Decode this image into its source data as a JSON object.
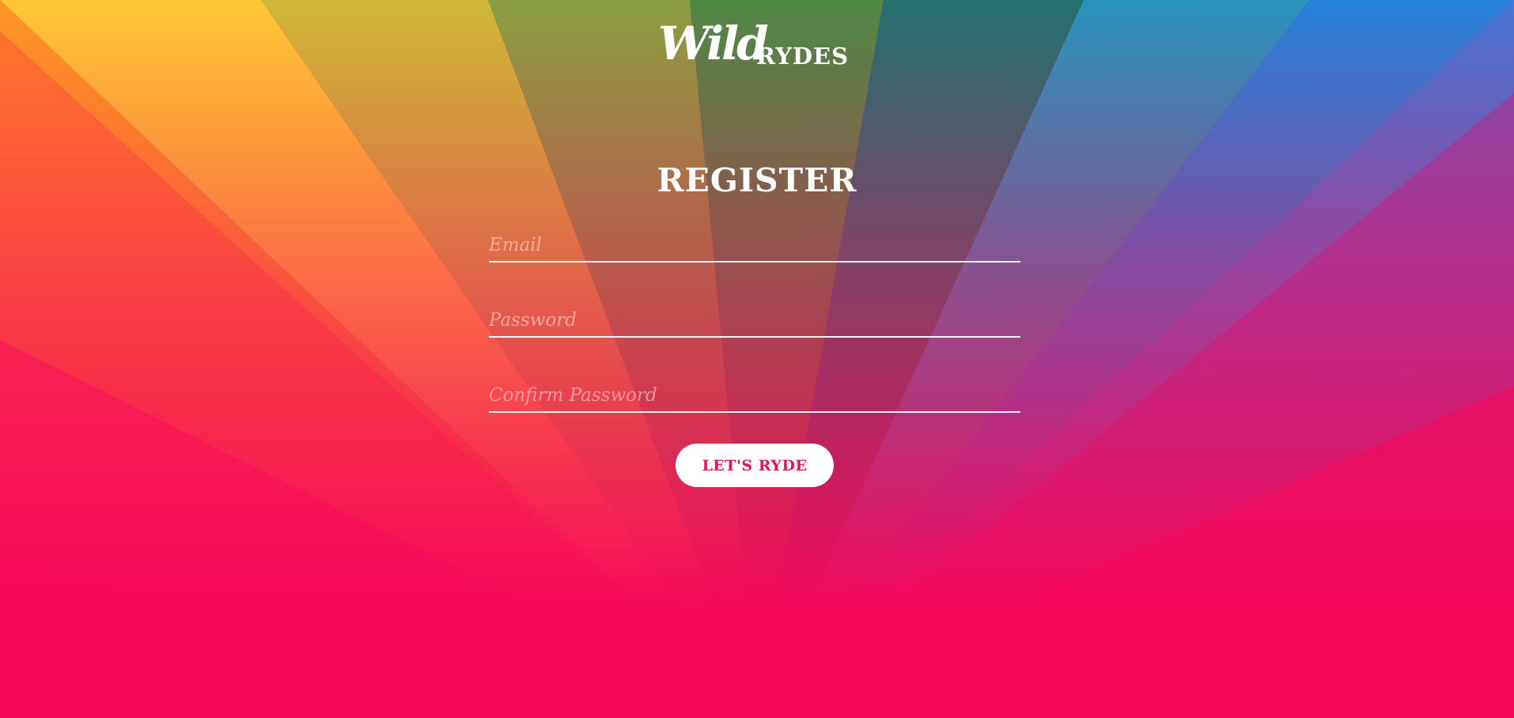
{
  "brand": {
    "logo_script": "Wild",
    "logo_caps": "RYDES"
  },
  "page": {
    "title": "REGISTER"
  },
  "form": {
    "email_placeholder": "Email",
    "password_placeholder": "Password",
    "confirm_password_placeholder": "Confirm Password",
    "submit_label": "LET'S RYDE"
  },
  "colors": {
    "accent": "#e5145a",
    "background_base": "#f5075a",
    "text": "#ffffff"
  }
}
